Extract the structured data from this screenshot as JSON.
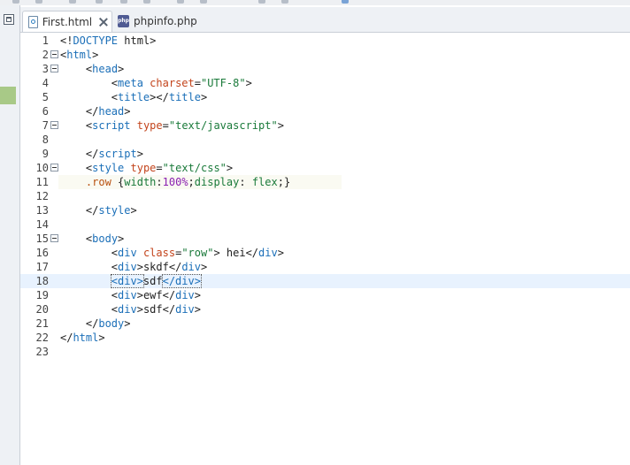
{
  "tabs": [
    {
      "label": "First.html",
      "active": true,
      "icon": "html-file-icon",
      "closable": true
    },
    {
      "label": "phpinfo.php",
      "active": false,
      "icon": "php-file-icon",
      "closable": false
    }
  ],
  "editor": {
    "current_line": 18,
    "lines": [
      {
        "n": "1",
        "fold": false,
        "tokens": [
          [
            "br",
            "<!"
          ],
          [
            "tag",
            "DOCTYPE"
          ],
          [
            "txt",
            " html"
          ],
          [
            "br",
            ">"
          ]
        ]
      },
      {
        "n": "2",
        "fold": true,
        "tokens": [
          [
            "br",
            "<"
          ],
          [
            "tag",
            "html"
          ],
          [
            "br",
            ">"
          ]
        ]
      },
      {
        "n": "3",
        "fold": true,
        "tokens": [
          [
            "txt",
            "    "
          ],
          [
            "br",
            "<"
          ],
          [
            "tag",
            "head"
          ],
          [
            "br",
            ">"
          ]
        ]
      },
      {
        "n": "4",
        "fold": false,
        "tokens": [
          [
            "txt",
            "        "
          ],
          [
            "br",
            "<"
          ],
          [
            "tag",
            "meta"
          ],
          [
            "txt",
            " "
          ],
          [
            "attr",
            "charset"
          ],
          [
            "txt",
            "="
          ],
          [
            "str",
            "\"UTF-8\""
          ],
          [
            "br",
            ">"
          ]
        ]
      },
      {
        "n": "5",
        "fold": false,
        "tokens": [
          [
            "txt",
            "        "
          ],
          [
            "br",
            "<"
          ],
          [
            "tag",
            "title"
          ],
          [
            "br",
            "></"
          ],
          [
            "tag",
            "title"
          ],
          [
            "br",
            ">"
          ]
        ]
      },
      {
        "n": "6",
        "fold": false,
        "tokens": [
          [
            "txt",
            "    "
          ],
          [
            "br",
            "</"
          ],
          [
            "tag",
            "head"
          ],
          [
            "br",
            ">"
          ]
        ]
      },
      {
        "n": "7",
        "fold": true,
        "tokens": [
          [
            "txt",
            "    "
          ],
          [
            "br",
            "<"
          ],
          [
            "tag",
            "script"
          ],
          [
            "txt",
            " "
          ],
          [
            "attr",
            "type"
          ],
          [
            "txt",
            "="
          ],
          [
            "str",
            "\"text/javascript\""
          ],
          [
            "br",
            ">"
          ]
        ]
      },
      {
        "n": "8",
        "fold": false,
        "tokens": []
      },
      {
        "n": "9",
        "fold": false,
        "tokens": [
          [
            "txt",
            "    "
          ],
          [
            "br",
            "</"
          ],
          [
            "tag",
            "script"
          ],
          [
            "br",
            ">"
          ]
        ]
      },
      {
        "n": "10",
        "fold": true,
        "tokens": [
          [
            "txt",
            "    "
          ],
          [
            "br",
            "<"
          ],
          [
            "tag",
            "style"
          ],
          [
            "txt",
            " "
          ],
          [
            "attr",
            "type"
          ],
          [
            "txt",
            "="
          ],
          [
            "str",
            "\"text/css\""
          ],
          [
            "br",
            ">"
          ]
        ]
      },
      {
        "n": "11",
        "fold": false,
        "partial": true,
        "tokens": [
          [
            "txt",
            "    "
          ],
          [
            "sel",
            ".row"
          ],
          [
            "txt",
            " "
          ],
          [
            "brace",
            "{"
          ],
          [
            "prop",
            "width"
          ],
          [
            "txt",
            ":"
          ],
          [
            "num",
            "100%"
          ],
          [
            "txt",
            ";"
          ],
          [
            "prop",
            "display"
          ],
          [
            "txt",
            ": "
          ],
          [
            "prop",
            "flex"
          ],
          [
            "txt",
            ";"
          ],
          [
            "brace",
            "}"
          ]
        ]
      },
      {
        "n": "12",
        "fold": false,
        "tokens": []
      },
      {
        "n": "13",
        "fold": false,
        "tokens": [
          [
            "txt",
            "    "
          ],
          [
            "br",
            "</"
          ],
          [
            "tag",
            "style"
          ],
          [
            "br",
            ">"
          ]
        ]
      },
      {
        "n": "14",
        "fold": false,
        "tokens": []
      },
      {
        "n": "15",
        "fold": true,
        "tokens": [
          [
            "txt",
            "    "
          ],
          [
            "br",
            "<"
          ],
          [
            "tag",
            "body"
          ],
          [
            "br",
            ">"
          ]
        ]
      },
      {
        "n": "16",
        "fold": false,
        "tokens": [
          [
            "txt",
            "        "
          ],
          [
            "br",
            "<"
          ],
          [
            "tag",
            "div"
          ],
          [
            "txt",
            " "
          ],
          [
            "attr",
            "class"
          ],
          [
            "txt",
            "="
          ],
          [
            "str",
            "\"row\""
          ],
          [
            "br",
            ">"
          ],
          [
            "txt",
            " hei"
          ],
          [
            "br",
            "</"
          ],
          [
            "tag",
            "div"
          ],
          [
            "br",
            ">"
          ]
        ]
      },
      {
        "n": "17",
        "fold": false,
        "tokens": [
          [
            "txt",
            "        "
          ],
          [
            "br",
            "<"
          ],
          [
            "tag",
            "div"
          ],
          [
            "br",
            ">"
          ],
          [
            "txt",
            "skdf"
          ],
          [
            "br",
            "</"
          ],
          [
            "tag",
            "div"
          ],
          [
            "br",
            ">"
          ]
        ]
      },
      {
        "n": "18",
        "fold": false,
        "tokens": [
          [
            "txt",
            "        "
          ],
          [
            "match",
            "<div>"
          ],
          [
            "txt",
            "sdf"
          ],
          [
            "match",
            "</div>"
          ]
        ]
      },
      {
        "n": "19",
        "fold": false,
        "tokens": [
          [
            "txt",
            "        "
          ],
          [
            "br",
            "<"
          ],
          [
            "tag",
            "div"
          ],
          [
            "br",
            ">"
          ],
          [
            "txt",
            "ewf"
          ],
          [
            "br",
            "</"
          ],
          [
            "tag",
            "div"
          ],
          [
            "br",
            ">"
          ]
        ]
      },
      {
        "n": "20",
        "fold": false,
        "tokens": [
          [
            "txt",
            "        "
          ],
          [
            "br",
            "<"
          ],
          [
            "tag",
            "div"
          ],
          [
            "br",
            ">"
          ],
          [
            "txt",
            "sdf"
          ],
          [
            "br",
            "</"
          ],
          [
            "tag",
            "div"
          ],
          [
            "br",
            ">"
          ]
        ]
      },
      {
        "n": "21",
        "fold": false,
        "tokens": [
          [
            "txt",
            "    "
          ],
          [
            "br",
            "</"
          ],
          [
            "tag",
            "body"
          ],
          [
            "br",
            ">"
          ]
        ]
      },
      {
        "n": "22",
        "fold": false,
        "tokens": [
          [
            "br",
            "</"
          ],
          [
            "tag",
            "html"
          ],
          [
            "br",
            ">"
          ]
        ]
      },
      {
        "n": "23",
        "fold": false,
        "tokens": []
      }
    ]
  },
  "colors": {
    "tag": "#1b6fb8",
    "attribute": "#c3441c",
    "string": "#1a7a3a",
    "number": "#8a1fb0",
    "selector": "#b8500f",
    "current_line_bg": "#e8f2fe"
  }
}
